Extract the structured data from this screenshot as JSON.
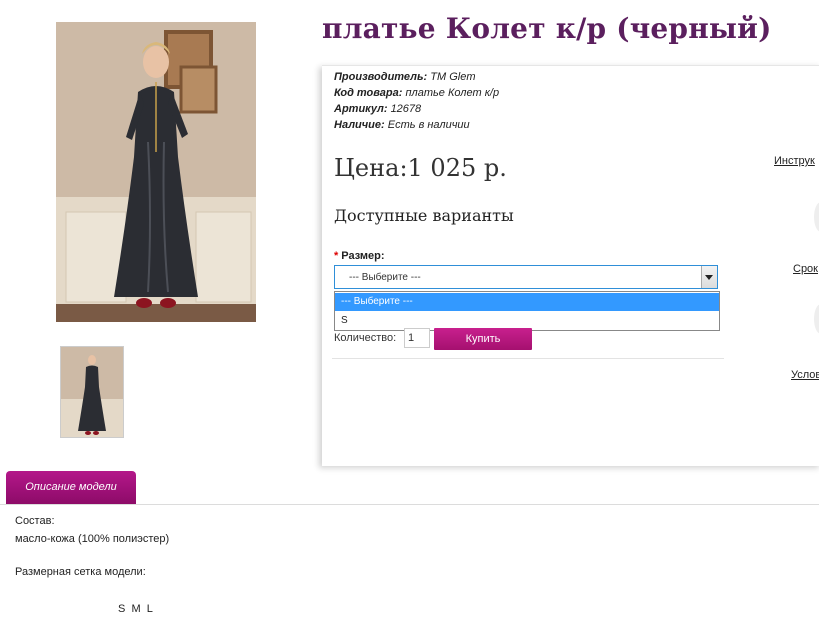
{
  "product": {
    "title": "платье Колет к/р (черный)",
    "price": "Цена:1 025 р."
  },
  "meta": {
    "manufacturer_label": "Производитель:",
    "manufacturer_value": "TM Glem",
    "code_label": "Код товара:",
    "code_value": "платье Колет к/р",
    "sku_label": "Артикул:",
    "sku_value": "12678",
    "stock_label": "Наличие:",
    "stock_value": "Есть в наличии"
  },
  "options": {
    "title": "Доступные варианты",
    "required_mark": "*",
    "size_label": "Размер:",
    "size_selected": "--- Выберите ---",
    "size_options": [
      "--- Выберите ---",
      "S"
    ]
  },
  "purchase": {
    "qty_label": "Количество:",
    "qty_value": "1",
    "buy_label": "Купить"
  },
  "right_links": [
    "Инструк",
    "Срок",
    "Услов"
  ],
  "tabs": {
    "description": "Описание модели"
  },
  "description": {
    "composition_label": "Состав:",
    "composition_value": "масло-кожа (100% полиэстер)",
    "size_chart_label": "Размерная сетка модели:",
    "sizes": "S  M  L"
  },
  "colors": {
    "title": "#5b1f5e",
    "accent": "#a5106f",
    "select_focus": "#2f8fd8",
    "option_highlight": "#3399ff"
  },
  "icons": [
    "dress-photo",
    "dress-thumbnail",
    "dropdown-arrow-icon"
  ]
}
